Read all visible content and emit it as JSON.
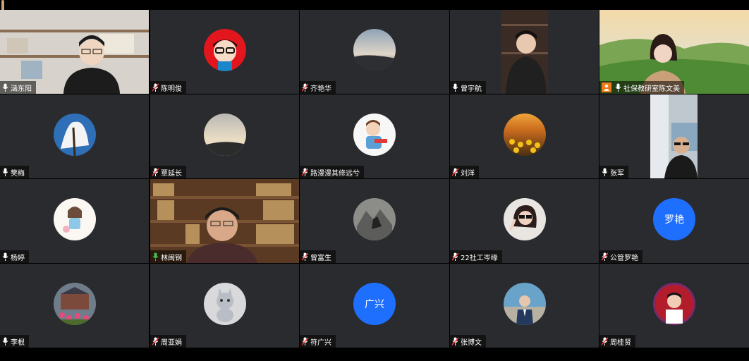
{
  "participants": [
    {
      "name": "涵东阳",
      "kind": "video",
      "scene": "shelf"
    },
    {
      "name": "陈明俊",
      "kind": "avatar",
      "avatar": "cartoon-red"
    },
    {
      "name": "齐艳华",
      "kind": "avatar",
      "avatar": "sky"
    },
    {
      "name": "曾宇航",
      "kind": "video",
      "scene": "man-center"
    },
    {
      "name": "社保教研室陈文美",
      "kind": "video",
      "scene": "landscape",
      "host": true
    },
    {
      "name": "樊梅",
      "kind": "avatar",
      "avatar": "snow-tree"
    },
    {
      "name": "覃延长",
      "kind": "avatar",
      "avatar": "sunset-hills"
    },
    {
      "name": "路漫漫其修远兮",
      "kind": "avatar",
      "avatar": "boy"
    },
    {
      "name": "刘洋",
      "kind": "avatar",
      "avatar": "sunflowers"
    },
    {
      "name": "张军",
      "kind": "video",
      "scene": "man-window"
    },
    {
      "name": "杨婷",
      "kind": "avatar",
      "avatar": "girl-draw"
    },
    {
      "name": "林闽钢",
      "kind": "video",
      "scene": "bookshelf",
      "active": true
    },
    {
      "name": "曾富生",
      "kind": "avatar",
      "avatar": "rocks"
    },
    {
      "name": "22社工岑缘",
      "kind": "avatar",
      "avatar": "woman-glasses"
    },
    {
      "name": "公管罗艳",
      "kind": "avatar",
      "avatar": "text",
      "text": "罗艳"
    },
    {
      "name": "李根",
      "kind": "avatar",
      "avatar": "flowers"
    },
    {
      "name": "周亚娟",
      "kind": "avatar",
      "avatar": "cat"
    },
    {
      "name": "符广兴",
      "kind": "avatar",
      "avatar": "text",
      "text": "广兴"
    },
    {
      "name": "张博文",
      "kind": "avatar",
      "avatar": "man-suit"
    },
    {
      "name": "周桂贤",
      "kind": "avatar",
      "avatar": "man-red"
    }
  ],
  "colors": {
    "tile": "#2a2b2e",
    "accent": "#1f6fff",
    "active": "#3fae49",
    "host": "#f07a1a"
  }
}
